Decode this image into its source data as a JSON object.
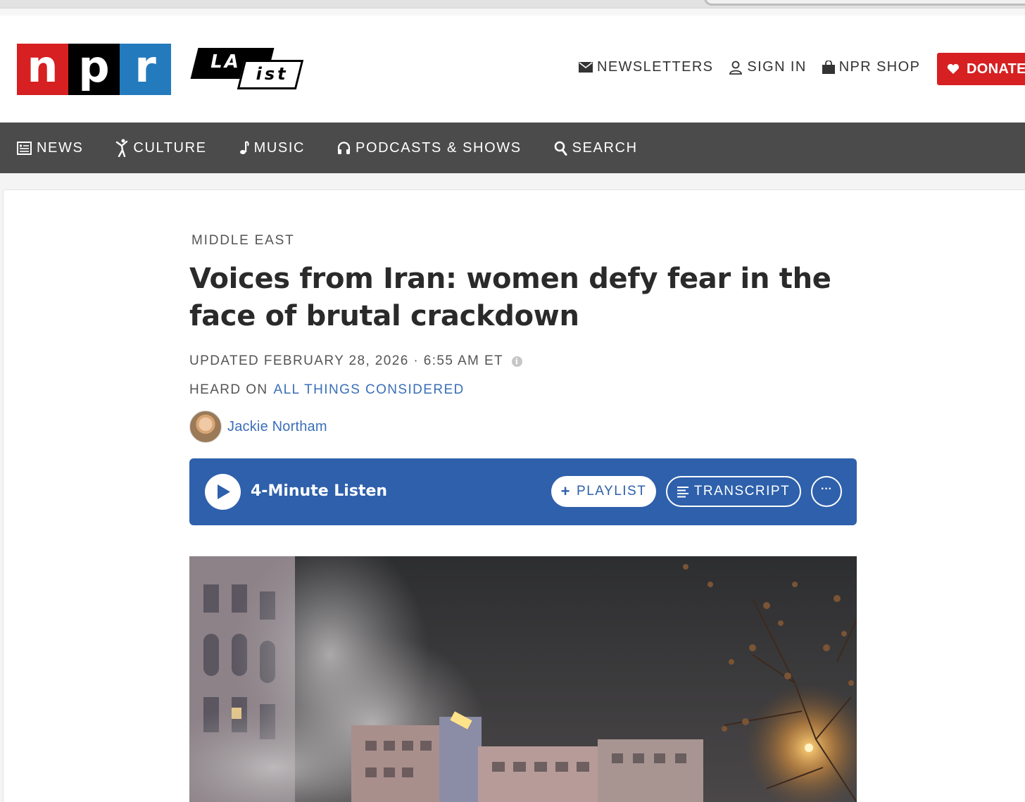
{
  "header": {
    "npr_letters": [
      "n",
      "p",
      "r"
    ],
    "laist": {
      "la": "LA",
      "ist": "ist"
    },
    "utility": [
      {
        "label": "NEWSLETTERS",
        "icon": "envelope-icon"
      },
      {
        "label": "SIGN IN",
        "icon": "person-icon"
      },
      {
        "label": "NPR SHOP",
        "icon": "shopping-bag-icon"
      }
    ],
    "donate": {
      "label": "DONATE",
      "icon": "heart-icon"
    }
  },
  "nav": [
    {
      "label": "NEWS",
      "icon": "newspaper-icon"
    },
    {
      "label": "CULTURE",
      "icon": "dancer-icon"
    },
    {
      "label": "MUSIC",
      "icon": "music-note-icon"
    },
    {
      "label": "PODCASTS & SHOWS",
      "icon": "headphones-icon"
    },
    {
      "label": "SEARCH",
      "icon": "search-icon"
    }
  ],
  "article": {
    "slug": "MIDDLE EAST",
    "headline": "Voices from Iran: women defy fear in the face of brutal crackdown",
    "dateline": "UPDATED FEBRUARY 28, 2026 · 6:55 AM ET",
    "heard_on_prefix": "HEARD ON",
    "heard_on_program": "ALL THINGS CONSIDERED",
    "author": "Jackie Northam"
  },
  "audio": {
    "listen_label": "4-Minute Listen",
    "playlist_label": "PLAYLIST",
    "transcript_label": "TRANSCRIPT",
    "more_label": "···"
  },
  "colors": {
    "npr_red": "#d62021",
    "npr_blue": "#237bbd",
    "nav_bg": "#4b4b4b",
    "audio_bar": "#2e60ab",
    "link_blue": "#3a6fb8"
  }
}
